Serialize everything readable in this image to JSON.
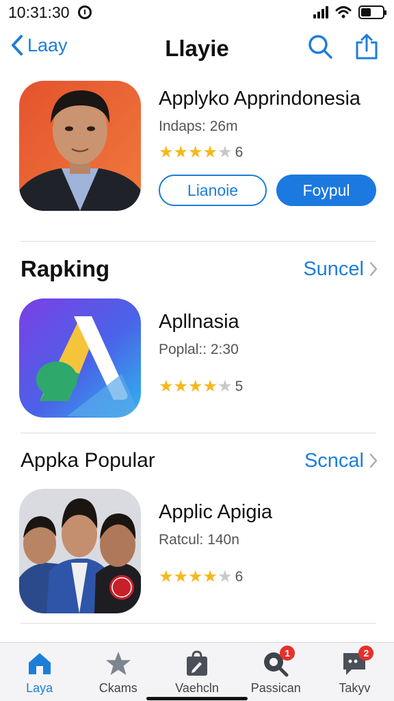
{
  "status_bar": {
    "time": "10:31:30"
  },
  "nav": {
    "back_label": "Laay",
    "title": "Llayie"
  },
  "featured": {
    "name": "Applyko Apprindonesia",
    "meta": "Indaps: 26m",
    "rating_stars": 4,
    "rating_count": "6",
    "secondary_button": "Lianoie",
    "primary_button": "Foypul"
  },
  "ranking": {
    "title": "Rapking",
    "see_all": "Suncel",
    "app": {
      "name": "Apllnasia",
      "meta": "Poplal:: 2:30",
      "rating_stars": 4,
      "rating_count": "5"
    }
  },
  "popular": {
    "title": "Appka Popular",
    "see_all": "Scncal",
    "app": {
      "name": "Applic Apigia",
      "meta": "Ratcul: 140n",
      "rating_stars": 4,
      "rating_count": "6"
    }
  },
  "tabs": [
    {
      "label": "Laya",
      "icon": "home-icon",
      "active": true
    },
    {
      "label": "Ckams",
      "icon": "star-icon",
      "active": false
    },
    {
      "label": "Vaehcln",
      "icon": "bag-icon",
      "active": false
    },
    {
      "label": "Passican",
      "icon": "search-icon",
      "badge": "1",
      "active": false
    },
    {
      "label": "Takyv",
      "icon": "chat-icon",
      "badge": "2",
      "active": false
    }
  ],
  "colors": {
    "accent": "#1d7ed8",
    "star": "#f6b81a",
    "badge": "#e8302c"
  }
}
